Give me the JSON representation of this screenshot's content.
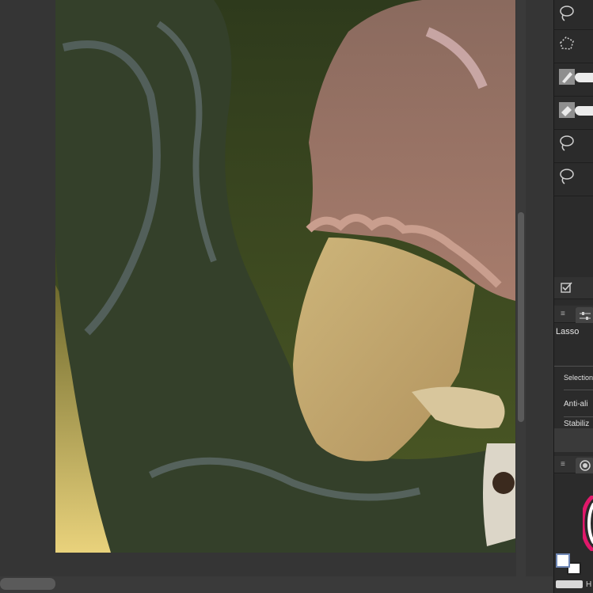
{
  "tool_panel": {
    "tools": [
      {
        "name": "lasso-tool",
        "icon": "lasso-icon"
      },
      {
        "name": "polyline-selection-tool",
        "icon": "polyline-selection-icon"
      },
      {
        "name": "selection-pen-tool",
        "icon": "selection-pen-icon"
      },
      {
        "name": "selection-eraser-tool",
        "icon": "selection-eraser-icon"
      },
      {
        "name": "lasso-tool-2",
        "icon": "lasso-icon"
      },
      {
        "name": "lasso-tool-3",
        "icon": "lasso-icon"
      }
    ]
  },
  "tool_property": {
    "title": "Lasso",
    "rows": [
      "Selection",
      "Anti-ali",
      "Stabiliz"
    ]
  },
  "bottom_letter": "H",
  "colors": {
    "panel_bg": "#2b2b2b",
    "canvas_bg": "#353535",
    "artwork_bg": "#3e4a1f",
    "fg_color": "#ffffff"
  }
}
